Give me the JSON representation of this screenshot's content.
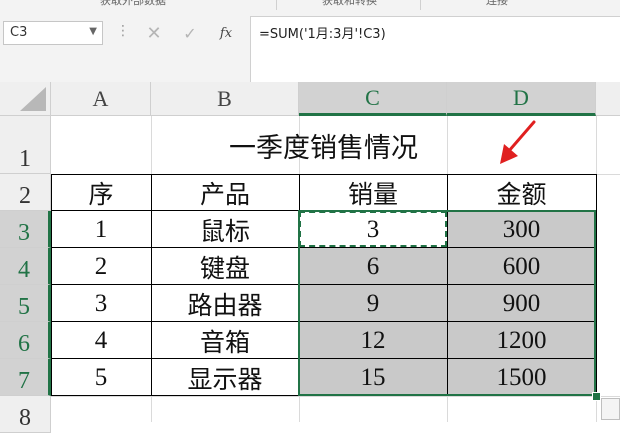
{
  "ribbon": {
    "groups": [
      "获取外部数据",
      "获取和转换",
      "连接"
    ]
  },
  "formula_bar": {
    "name_box": "C3",
    "formula": "=SUM('1月:3月'!C3)",
    "fx_label": "fx"
  },
  "columns": [
    "A",
    "B",
    "C",
    "D"
  ],
  "rows": [
    "1",
    "2",
    "3",
    "4",
    "5",
    "6",
    "7",
    "8"
  ],
  "sheet": {
    "title": "一季度销售情况",
    "headers": [
      "序",
      "产品",
      "销量",
      "金额"
    ],
    "data_rows": [
      {
        "index": "1",
        "product": "鼠标",
        "qty": "3",
        "amount": "300"
      },
      {
        "index": "2",
        "product": "键盘",
        "qty": "6",
        "amount": "600"
      },
      {
        "index": "3",
        "product": "路由器",
        "qty": "9",
        "amount": "900"
      },
      {
        "index": "4",
        "product": "音箱",
        "qty": "12",
        "amount": "1200"
      },
      {
        "index": "5",
        "product": "显示器",
        "qty": "15",
        "amount": "1500"
      }
    ]
  },
  "colors": {
    "accent": "#217346",
    "arrow": "#e02020",
    "selected_fill": "#c9c9c9"
  }
}
